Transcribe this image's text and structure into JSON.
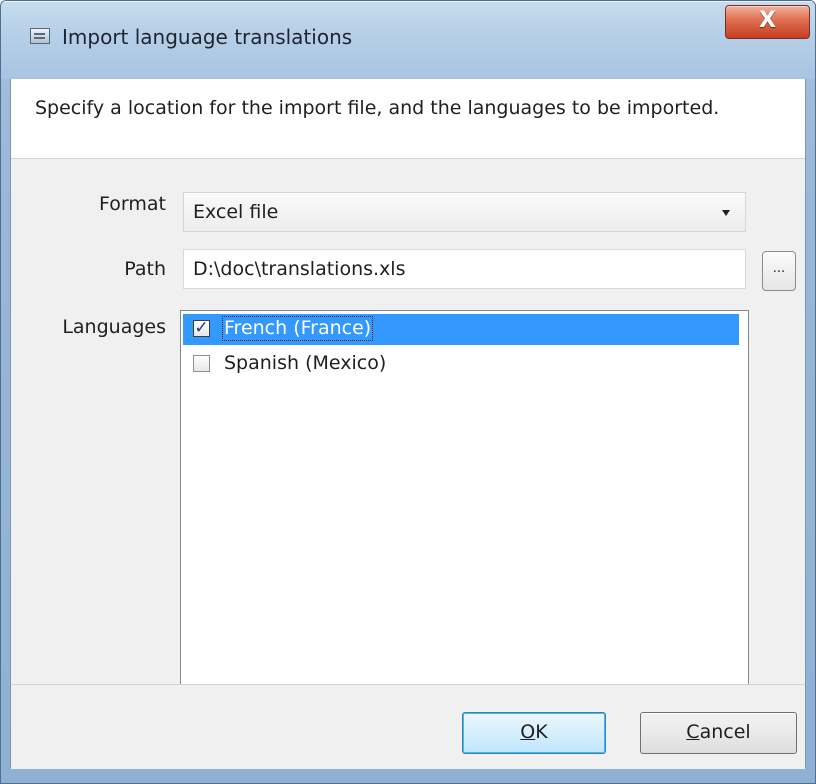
{
  "window": {
    "title": "Import language translations",
    "close_label": "X"
  },
  "instruction": {
    "text": "Specify a location for the import file, and the languages to be imported."
  },
  "fields": {
    "format_label": "Format",
    "format_value": "Excel file",
    "path_label": "Path",
    "path_value": "D:\\doc\\translations.xls",
    "browse_label": "...",
    "languages_label": "Languages"
  },
  "languages": [
    {
      "label": "French (France)",
      "checked": true,
      "selected": true
    },
    {
      "label": "Spanish (Mexico)",
      "checked": false,
      "selected": false
    }
  ],
  "buttons": {
    "ok_label": "OK",
    "cancel_label": "Cancel"
  },
  "icons": {
    "title_icon": "language-dialog-icon",
    "dropdown_icon": "chevron-down-icon",
    "checkmark_icon": "checkmark-icon"
  },
  "colors": {
    "selection": "#3399ff",
    "close_button": "#c73e20",
    "ok_button_border": "#3c7fb1"
  }
}
